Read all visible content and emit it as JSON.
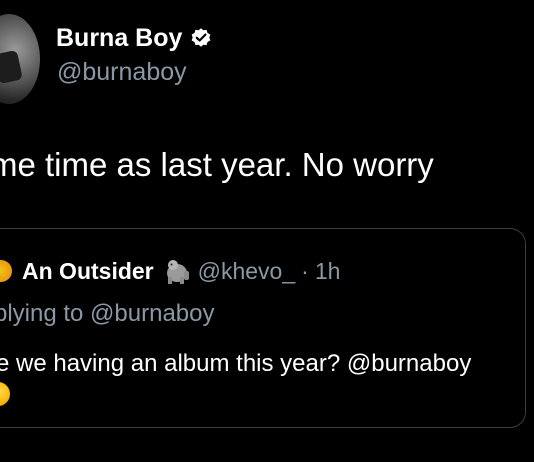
{
  "tweet": {
    "author": {
      "display_name": "Burna Boy",
      "handle": "@burnaboy",
      "verified": true
    },
    "text": "me time as last year. No worry",
    "quoted_tweet": {
      "author_name": "An Outsider",
      "author_handle": "@khevo_",
      "separator": "·",
      "time": "1h",
      "replying_to": "plying to @burnaboy",
      "text": "e we having an album this year? @burnaboy"
    }
  },
  "colors": {
    "background": "#000000",
    "primary_text": "#ffffff",
    "secondary_text": "#8b98a5",
    "card_border": "#3a3f44"
  },
  "icons": {
    "verified": "verified-badge-icon",
    "author_emoji": "gorilla-icon",
    "quote_avatar": "avatar-icon",
    "trailing_emoji": "emoji-icon"
  }
}
